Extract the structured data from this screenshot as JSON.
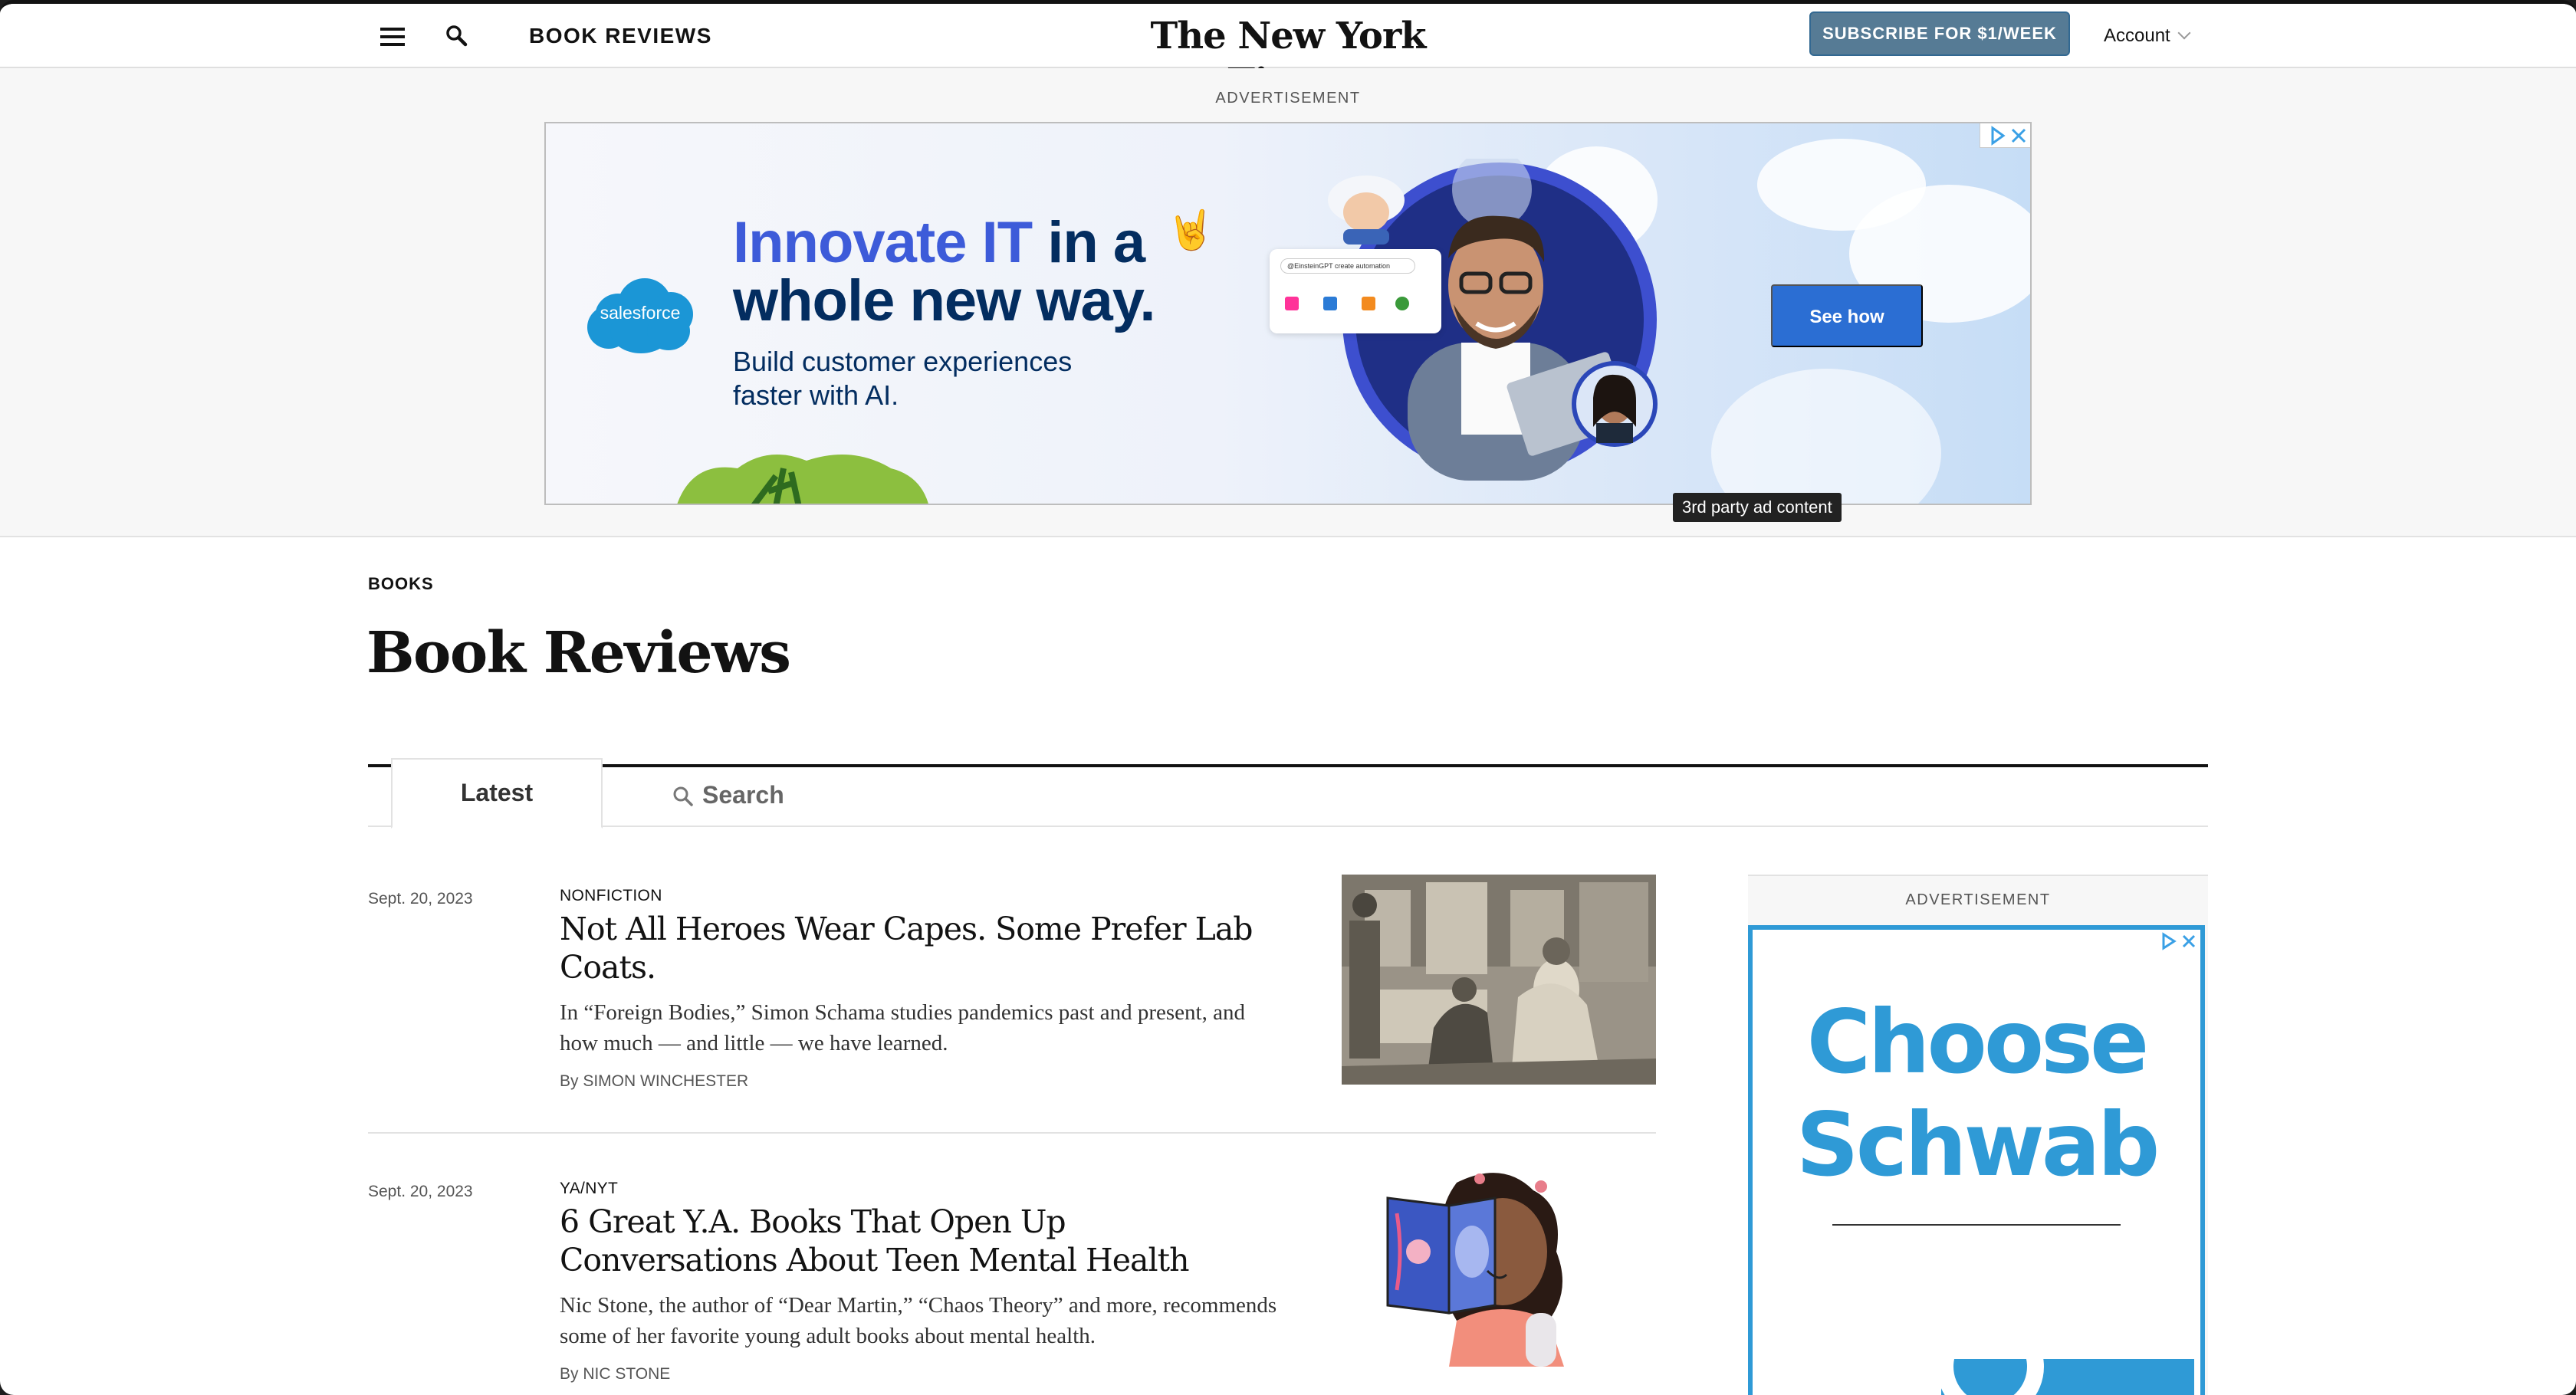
{
  "masthead": {
    "section_name": "BOOK REVIEWS",
    "logo_text": "The New York Times",
    "subscribe_label": "SUBSCRIBE FOR $1/WEEK",
    "account_label": "Account"
  },
  "top_ad": {
    "label": "ADVERTISEMENT",
    "brand": "salesforce",
    "headline_highlight": "Innovate IT",
    "headline_rest": " in a",
    "headline_line2": "whole new way.",
    "subline_1": "Build customer experiences",
    "subline_2": "faster with AI.",
    "cta_label": "See how",
    "tooltip": "3rd party ad content"
  },
  "page": {
    "kicker": "BOOKS",
    "title": "Book Reviews"
  },
  "tabs": {
    "latest_label": "Latest",
    "search_label": "Search"
  },
  "articles": [
    {
      "date": "Sept. 20, 2023",
      "kicker": "NONFICTION",
      "headline": "Not All Heroes Wear Capes. Some Prefer Lab Coats.",
      "summary": "In “Foreign Bodies,” Simon Schama studies pandemics past and present, and how much — and little — we have learned.",
      "byline": "By SIMON WINCHESTER"
    },
    {
      "date": "Sept. 20, 2023",
      "kicker": "YA/NYT",
      "headline": "6 Great Y.A. Books That Open Up Conversations About Teen Mental Health",
      "summary": "Nic Stone, the author of “Dear Martin,” “Chaos Theory” and more, recommends some of her favorite young adult books about mental health.",
      "byline": "By NIC STONE"
    }
  ],
  "side_ad": {
    "label": "ADVERTISEMENT",
    "line1": "Choose",
    "line2": "Schwab"
  },
  "icons": [
    "menu-icon",
    "search-icon",
    "chevron-down-icon",
    "adchoices-icon",
    "close-icon"
  ],
  "colors": {
    "subscribe": "#567b95",
    "ad_cta": "#2b6ed3",
    "schwab_blue": "#2f9ad6",
    "salesforce_blue": "#1b96d6"
  }
}
